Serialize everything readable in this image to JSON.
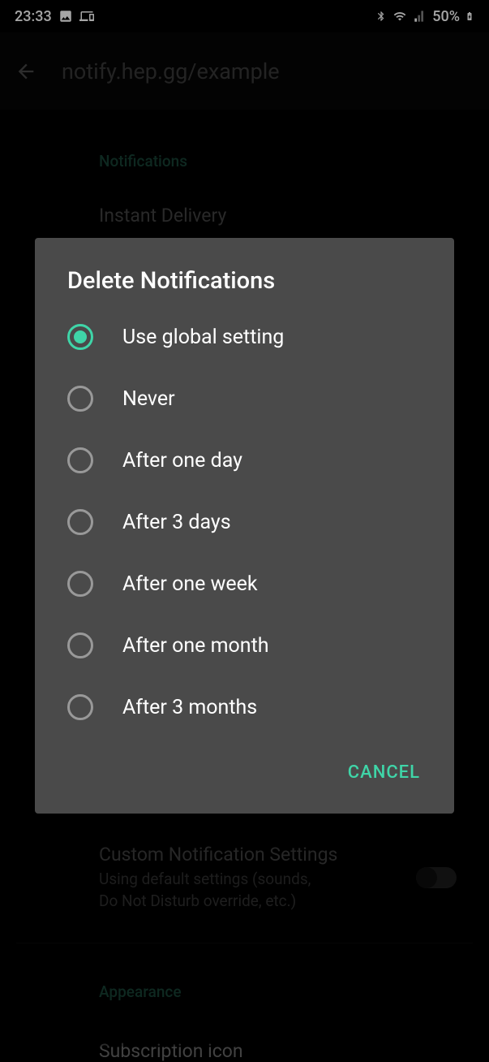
{
  "status_bar": {
    "time": "23:33",
    "battery": "50%"
  },
  "app_bar": {
    "title": "notify.hep.gg/example"
  },
  "sections": {
    "notifications_label": "Notifications",
    "instant_delivery_title": "Instant Delivery",
    "custom_title": "Custom Notification Settings",
    "custom_sub1": "Using default settings (sounds,",
    "custom_sub2": "Do Not Disturb override, etc.)",
    "appearance_label": "Appearance",
    "sub_icon_title": "Subscription icon"
  },
  "dialog": {
    "title": "Delete Notifications",
    "options": [
      "Use global setting",
      "Never",
      "After one day",
      "After 3 days",
      "After one week",
      "After one month",
      "After 3 months"
    ],
    "selected_index": 0,
    "cancel_label": "CANCEL"
  }
}
